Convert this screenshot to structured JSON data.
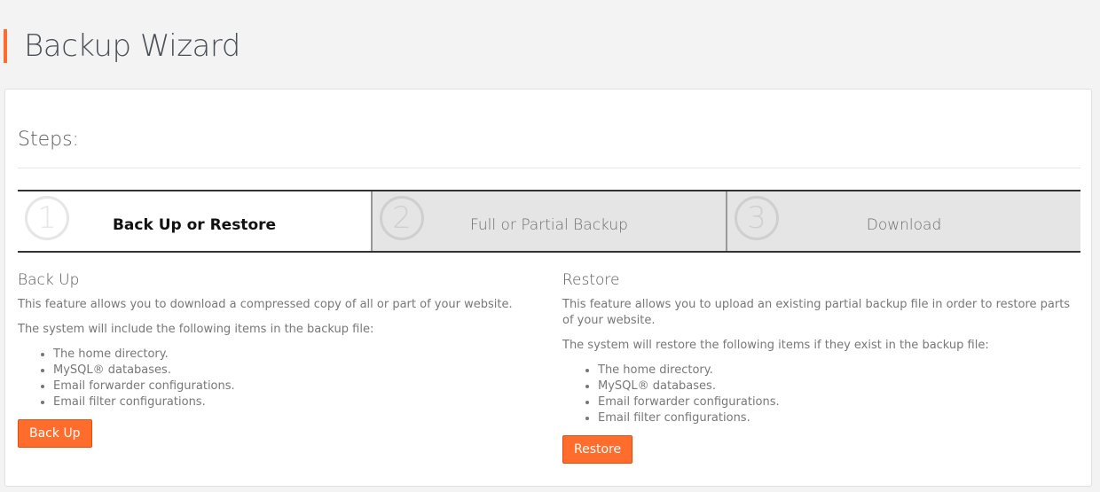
{
  "header": {
    "title": "Backup Wizard",
    "accent_color": "#ff6c2c"
  },
  "steps": {
    "heading": "Steps:",
    "items": [
      {
        "number": "1",
        "label": "Back Up or Restore",
        "active": true
      },
      {
        "number": "2",
        "label": "Full or Partial Backup",
        "active": false
      },
      {
        "number": "3",
        "label": "Download",
        "active": false
      }
    ]
  },
  "backup": {
    "title": "Back Up",
    "description": "This feature allows you to download a compressed copy of all or part of your website.",
    "list_intro": "The system will include the following items in the backup file:",
    "items": [
      "The home directory.",
      "MySQL® databases.",
      "Email forwarder configurations.",
      "Email filter configurations."
    ],
    "button_label": "Back Up"
  },
  "restore": {
    "title": "Restore",
    "description": "This feature allows you to upload an existing partial backup file in order to restore parts of your website.",
    "list_intro": "The system will restore the following items if they exist in the backup file:",
    "items": [
      "The home directory.",
      "MySQL® databases.",
      "Email forwarder configurations.",
      "Email filter configurations."
    ],
    "button_label": "Restore"
  }
}
